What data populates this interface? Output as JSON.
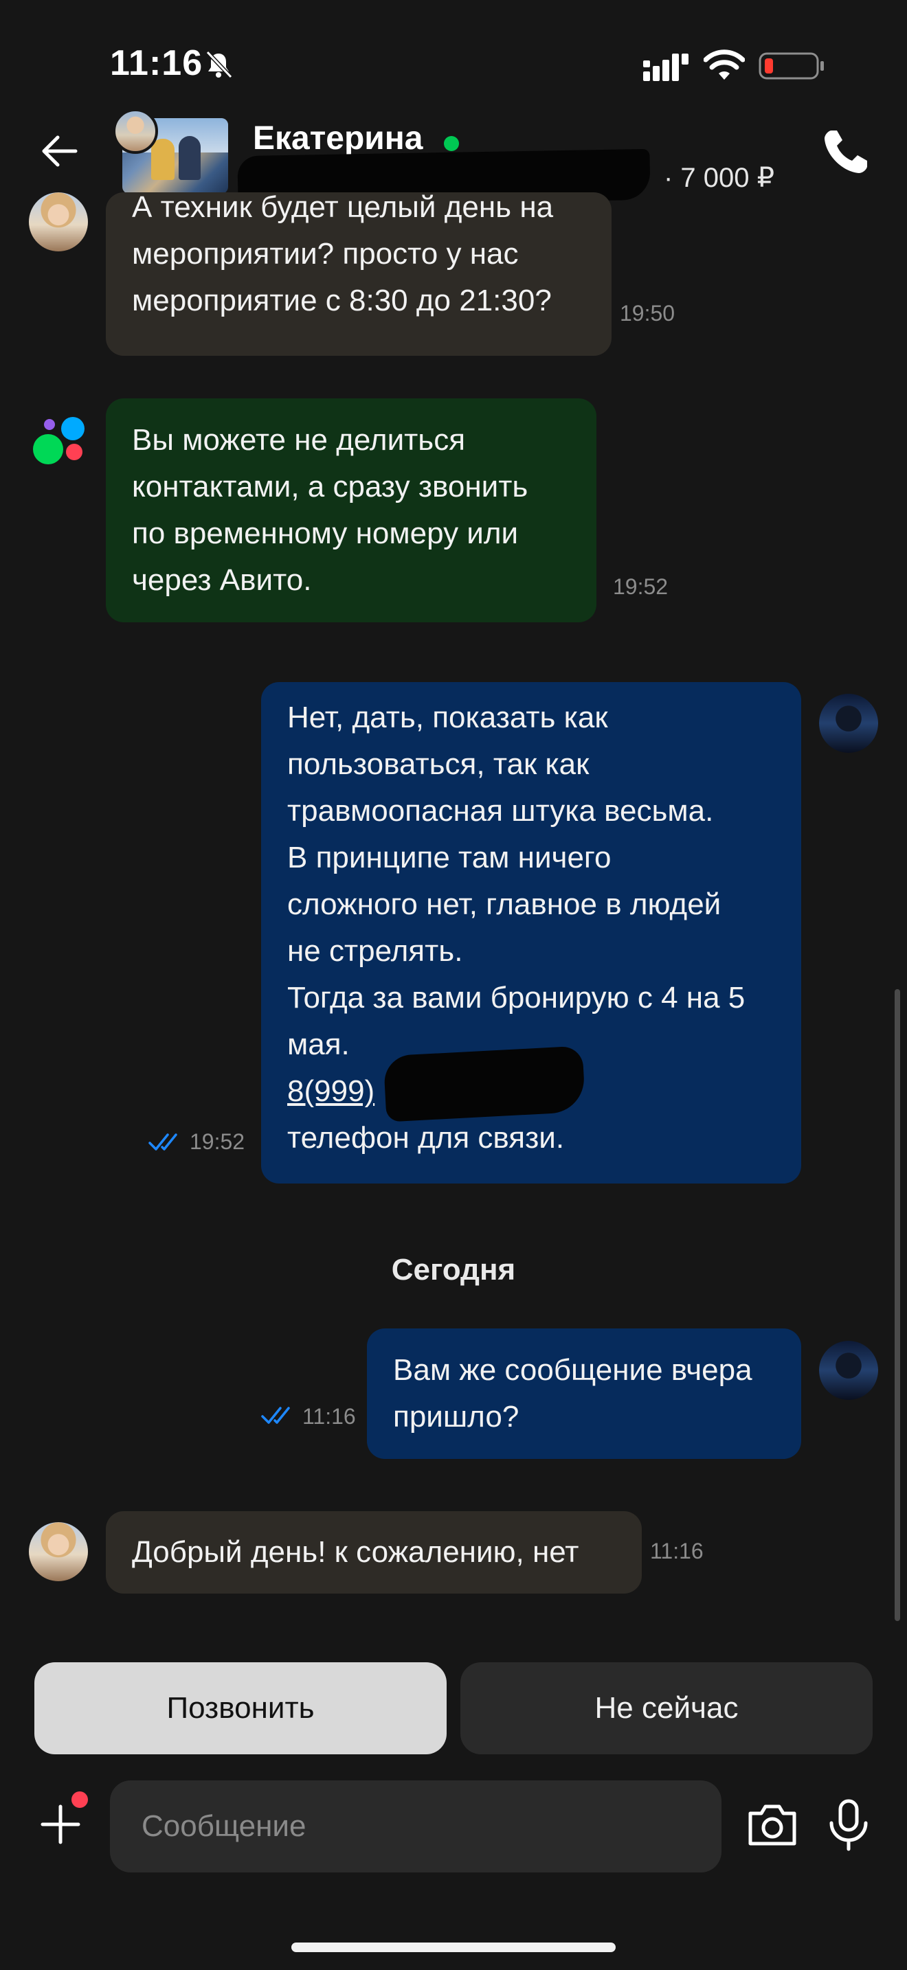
{
  "status_bar": {
    "time": "11:16",
    "icons": [
      "bell-off-icon",
      "cellular-signal-icon",
      "wifi-icon",
      "battery-low-icon"
    ],
    "battery_color": "#ff3b30"
  },
  "header": {
    "contact_name": "Екатерина",
    "online": true,
    "online_color": "#00c853",
    "ad_price": "· 7 000 ₽"
  },
  "messages": [
    {
      "direction": "in",
      "lines": [
        "А техник будет целый день на",
        "мероприятии? просто у нас",
        "мероприятие с 8:30 до 21:30?"
      ],
      "time": "19:50"
    },
    {
      "direction": "system",
      "sender": "Авито",
      "lines": [
        "Вы можете не делиться",
        "контактами, а сразу звонить",
        "по временному номеру или",
        "через Авито."
      ],
      "time": "19:52"
    },
    {
      "direction": "out",
      "lines": [
        "Нет, дать, показать как",
        "пользоваться, так как",
        "травмоопасная штука весьма.",
        "В принципе там ничего",
        "сложного нет, главное в людей",
        "не стрелять.",
        "Тогда за вами бронирую с 4 на 5",
        "мая."
      ],
      "phone_visible": "8(999)",
      "last_line": "телефон для связи.",
      "time": "19:52",
      "status": "read"
    }
  ],
  "day_divider": "Сегодня",
  "messages_today": [
    {
      "direction": "out",
      "lines": [
        "Вам же сообщение вчера",
        "пришло?"
      ],
      "time": "11:16",
      "status": "read"
    },
    {
      "direction": "in",
      "lines": [
        "Добрый день! к сожалению, нет"
      ],
      "time": "11:16"
    }
  ],
  "quick_actions": {
    "call": "Позвонить",
    "later": "Не сейчас"
  },
  "composer": {
    "placeholder": "Сообщение",
    "value": ""
  },
  "colors": {
    "background": "#161616",
    "bubble_in": "#2e2b26",
    "bubble_system": "#0f3316",
    "bubble_out": "#062b5c",
    "read_check": "#1e88ff"
  }
}
